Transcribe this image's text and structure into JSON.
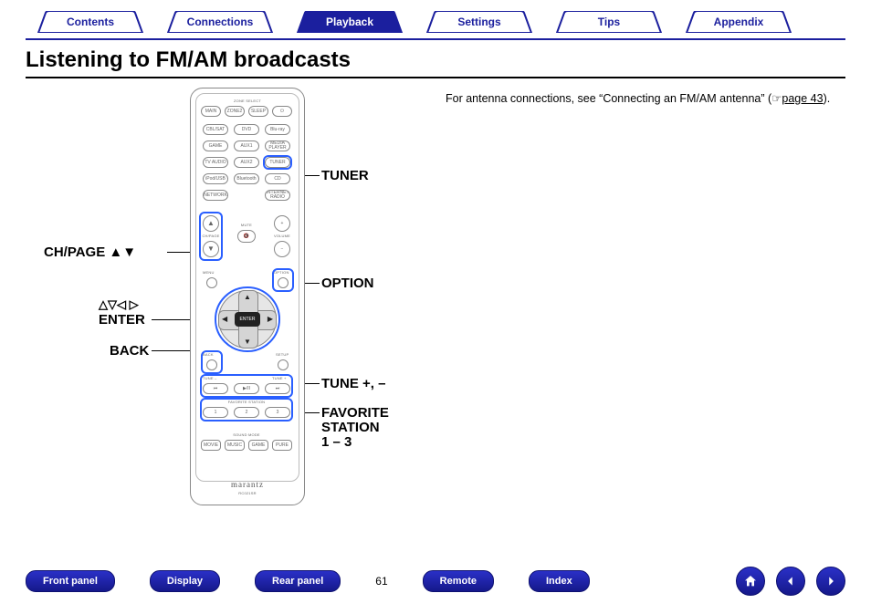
{
  "tabs": {
    "items": [
      {
        "label": "Contents",
        "active": false
      },
      {
        "label": "Connections",
        "active": false
      },
      {
        "label": "Playback",
        "active": true
      },
      {
        "label": "Settings",
        "active": false
      },
      {
        "label": "Tips",
        "active": false
      },
      {
        "label": "Appendix",
        "active": false
      }
    ]
  },
  "heading": "Listening to FM/AM broadcasts",
  "body_text": {
    "prefix": "For antenna connections, see “Connecting an FM/AM antenna” (",
    "link_icon": "☞",
    "link": "page 43",
    "suffix": ")."
  },
  "callouts": {
    "ch_page": "CH/PAGE",
    "ch_page_icons": "▲▼",
    "arrows": "△▽◁ ▷",
    "enter": "ENTER",
    "back": "BACK",
    "tuner": "TUNER",
    "option": "OPTION",
    "tune": "TUNE +, –",
    "fav_l1": "FAVORITE",
    "fav_l2": "STATION",
    "fav_l3": "1 – 3"
  },
  "remote_text": {
    "zone_select": "ZONE SELECT",
    "row1": [
      "MAIN",
      "ZONE2",
      "SLEEP",
      "⏻"
    ],
    "row2": [
      "CBL/SAT",
      "DVD",
      "Blu-ray"
    ],
    "row3": [
      "GAME",
      "AUX1",
      "MEDIA PLAYER"
    ],
    "row4": [
      "TV AUDIO",
      "AUX2",
      "TUNER"
    ],
    "row5": [
      "iPod/USB",
      "Bluetooth",
      "CD"
    ],
    "row6": [
      "NETWORK",
      "",
      "INTERNET RADIO"
    ],
    "ch_page": "CH/PAGE",
    "mute": "MUTE",
    "vol": "VOLUME",
    "menu": "MENU",
    "option": "OPTION",
    "back": "BACK",
    "setup": "SETUP",
    "enter": "ENTER",
    "tune_minus": "TUNE –",
    "tune_plus": "TUNE +",
    "play": "▶/II",
    "prev": "⏮",
    "next": "⏭",
    "fav_label": "FAVORITE STATION",
    "fav": [
      "1",
      "2",
      "3"
    ],
    "row_bottom": [
      "MOVIE",
      "MUSIC",
      "GAME",
      "PURE"
    ],
    "sound_mode": "SOUND MODE",
    "brand": "marantz",
    "model": "RC021SR"
  },
  "bottom": {
    "buttons": [
      "Front panel",
      "Display",
      "Rear panel"
    ],
    "page": "61",
    "buttons2": [
      "Remote",
      "Index"
    ],
    "circles": [
      "home-icon",
      "prev-icon",
      "next-icon"
    ]
  }
}
